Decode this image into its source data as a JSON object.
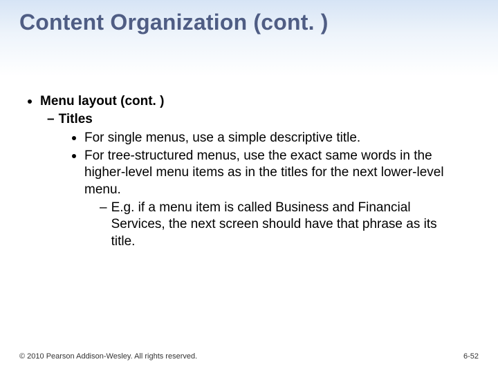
{
  "title": "Content Organization (cont. )",
  "bullets": {
    "lvl1": "Menu layout (cont. )",
    "lvl2": "Titles",
    "lvl3a": "For single menus, use a simple descriptive title.",
    "lvl3b": "For tree-structured menus, use the exact same words in the higher-level menu items as in the titles for the next lower-level menu.",
    "lvl4": "E.g. if a menu item is called Business and Financial Services, the next screen should have that phrase as its title."
  },
  "footer": {
    "copyright": "© 2010 Pearson Addison-Wesley. All rights reserved.",
    "page": "6-52"
  }
}
